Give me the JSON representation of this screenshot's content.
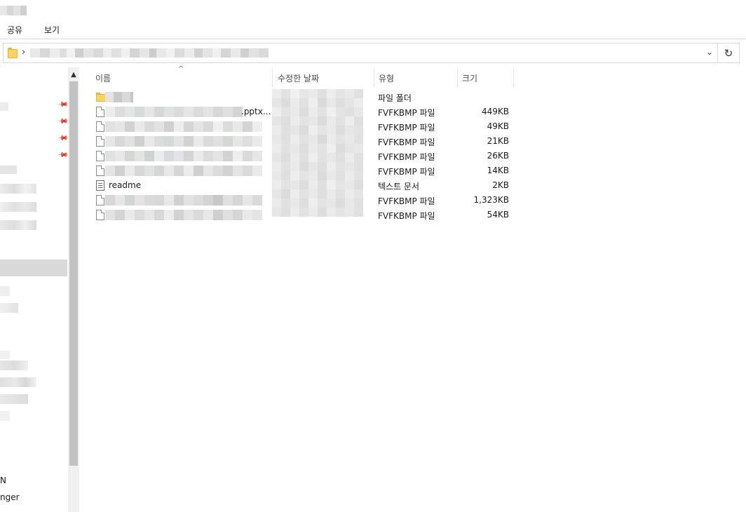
{
  "ribbon": {
    "tabs": [
      {
        "label": "공유"
      },
      {
        "label": "보기"
      }
    ]
  },
  "icons": {
    "address_dropdown": "chevron-down-icon",
    "refresh": "refresh-icon",
    "pin": "pin-icon",
    "scroll_up": "scroll-up-arrow-icon",
    "sort": "sort-ascending-icon"
  },
  "columns": {
    "name": "이름",
    "date": "수정한 날짜",
    "type": "유형",
    "size": "크기"
  },
  "files": [
    {
      "name": "",
      "type": "파일 폴더",
      "size": "",
      "icon": "folder-icon"
    },
    {
      "name": ".pptx...",
      "type": "FVFKBMP 파일",
      "size": "449KB",
      "icon": "file-icon"
    },
    {
      "name": "",
      "type": "FVFKBMP 파일",
      "size": "49KB",
      "icon": "file-icon"
    },
    {
      "name": "",
      "type": "FVFKBMP 파일",
      "size": "21KB",
      "icon": "file-icon"
    },
    {
      "name": "",
      "type": "FVFKBMP 파일",
      "size": "26KB",
      "icon": "file-icon"
    },
    {
      "name": "",
      "type": "FVFKBMP 파일",
      "size": "14KB",
      "icon": "file-icon"
    },
    {
      "name": "readme",
      "type": "텍스트 문서",
      "size": "2KB",
      "icon": "text-document-icon"
    },
    {
      "name": "",
      "type": "FVFKBMP 파일",
      "size": "1,323KB",
      "icon": "file-icon"
    },
    {
      "name": "",
      "type": "FVFKBMP 파일",
      "size": "54KB",
      "icon": "file-icon"
    }
  ],
  "nav": {
    "bottom_items": [
      {
        "label": "N"
      },
      {
        "label": "nger"
      }
    ]
  },
  "colors": {
    "selection": "#d9d9d9",
    "folder": "#ffd35c",
    "scroll_thumb": "#c2c2c2"
  }
}
